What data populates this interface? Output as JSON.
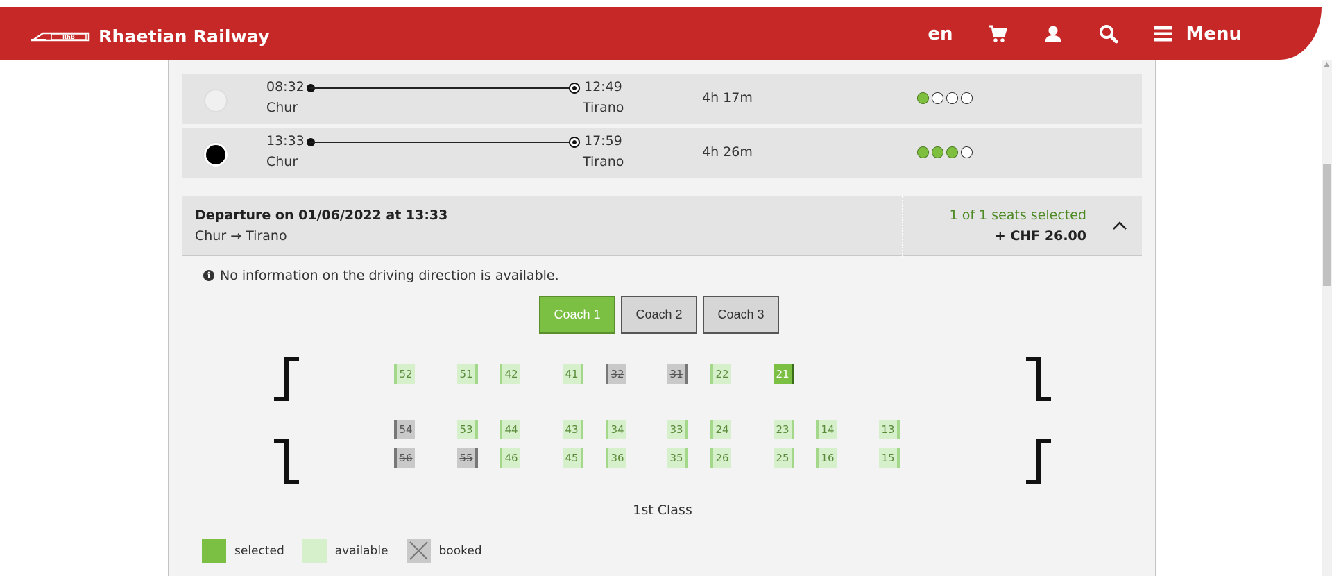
{
  "header": {
    "brand": "Rhaetian Railway",
    "logo_mark_text": "RhB",
    "lang": "en",
    "menu_label": "Menu",
    "icons": [
      "cart-icon",
      "user-icon",
      "search-icon",
      "menu-icon"
    ],
    "bg_color": "#c62828"
  },
  "connections": [
    {
      "dep_time": "08:32",
      "dep_station": "Chur",
      "arr_time": "12:49",
      "arr_station": "Tirano",
      "duration": "4h 17m",
      "occupancy": 1,
      "selected": false
    },
    {
      "dep_time": "13:33",
      "dep_station": "Chur",
      "arr_time": "17:59",
      "arr_station": "Tirano",
      "duration": "4h 26m",
      "occupancy": 3,
      "selected": true
    }
  ],
  "departure": {
    "title": "Departure on 01/06/2022 at 13:33",
    "route": "Chur → Tirano",
    "seats_selected": "1 of 1 seats selected",
    "price": "+ CHF 26.00"
  },
  "info": {
    "icon": "info-icon",
    "text": "No information on the driving direction is available."
  },
  "coaches": [
    {
      "label": "Coach 1",
      "active": true
    },
    {
      "label": "Coach 2",
      "active": false
    },
    {
      "label": "Coach 3",
      "active": false
    }
  ],
  "seats": {
    "top_row": [
      {
        "n": "52",
        "state": "available"
      },
      {
        "n": "51",
        "state": "available"
      },
      {
        "n": "42",
        "state": "available"
      },
      {
        "n": "41",
        "state": "available"
      },
      {
        "n": "32",
        "state": "booked"
      },
      {
        "n": "31",
        "state": "booked"
      },
      {
        "n": "22",
        "state": "available"
      },
      {
        "n": "21",
        "state": "selected"
      }
    ],
    "middle_row": [
      {
        "n": "54",
        "state": "booked"
      },
      {
        "n": "53",
        "state": "available"
      },
      {
        "n": "44",
        "state": "available"
      },
      {
        "n": "43",
        "state": "available"
      },
      {
        "n": "34",
        "state": "available"
      },
      {
        "n": "33",
        "state": "available"
      },
      {
        "n": "24",
        "state": "available"
      },
      {
        "n": "23",
        "state": "available"
      },
      {
        "n": "14",
        "state": "available"
      },
      {
        "n": "13",
        "state": "available"
      }
    ],
    "bottom_row": [
      {
        "n": "56",
        "state": "booked"
      },
      {
        "n": "55",
        "state": "booked"
      },
      {
        "n": "46",
        "state": "available"
      },
      {
        "n": "45",
        "state": "available"
      },
      {
        "n": "36",
        "state": "available"
      },
      {
        "n": "35",
        "state": "available"
      },
      {
        "n": "26",
        "state": "available"
      },
      {
        "n": "25",
        "state": "available"
      },
      {
        "n": "16",
        "state": "available"
      },
      {
        "n": "15",
        "state": "available"
      }
    ]
  },
  "class_label": "1st Class",
  "legend": {
    "selected": "selected",
    "available": "available",
    "booked": "booked"
  },
  "colors": {
    "selected": "#7cc043",
    "available": "#d6f0cb",
    "booked": "#c9c9c9",
    "occupancy_fill": "#7fbf3f"
  }
}
